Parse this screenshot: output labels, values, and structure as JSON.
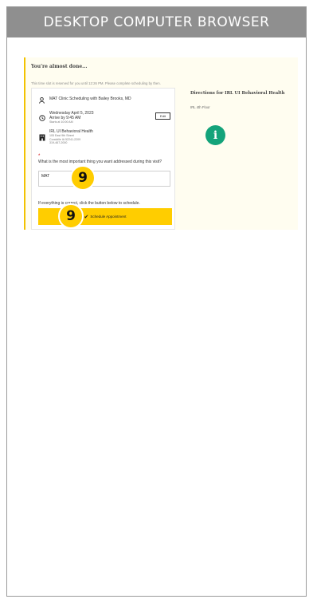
{
  "banner": {
    "label": "DESKTOP COMPUTER BROWSER"
  },
  "page": {
    "title": "You're almost done...",
    "reserved_notice": "This time slot is reserved for you until 12:26 PM. Please complete scheduling by then."
  },
  "appointment": {
    "visit_type": "MAT Clinic Scheduling with Bailey Brooks, MD",
    "date": "Wednesday April 5, 2023",
    "arrive": "Arrive by 9:45 AM",
    "starts": "Starts at 10:00 AM",
    "edit_label": "Edit",
    "location_name": "IRL UI Behavioral Health",
    "address_line1": "105 East 9th Street",
    "address_line2": "Coralville IA 52241-2209",
    "phone": "319-467-2000"
  },
  "form": {
    "required_mark": "*",
    "question": "What is the most important thing you want addressed during this visit?",
    "answer": "MAT",
    "confirm_text": "If everything is correct, click the button below to schedule.",
    "schedule_label": "Schedule Appointment"
  },
  "steps": {
    "marker_a": "9",
    "marker_b": "9"
  },
  "directions": {
    "title": "Directions for IRL UI Behavioral Health",
    "floor": "IRL 4th Floor"
  },
  "icons": {
    "provider": "person-icon",
    "time": "clock-icon",
    "location": "building-icon",
    "info": "info-icon"
  },
  "colors": {
    "accent": "#ffcd00",
    "info": "#14a37a",
    "banner": "#8f8f8f"
  }
}
